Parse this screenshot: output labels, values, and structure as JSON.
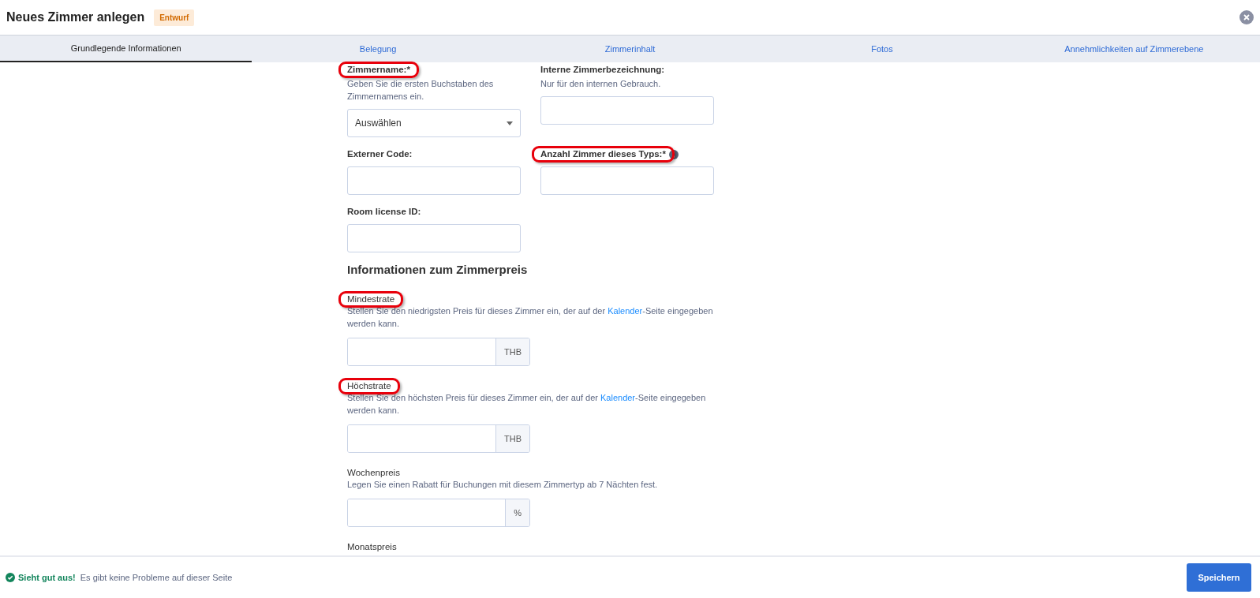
{
  "header": {
    "title": "Neues Zimmer anlegen",
    "badge": "Entwurf"
  },
  "tabs": [
    {
      "label": "Grundlegende Informationen",
      "selected": true
    },
    {
      "label": "Belegung",
      "selected": false
    },
    {
      "label": "Zimmerinhalt",
      "selected": false
    },
    {
      "label": "Fotos",
      "selected": false
    },
    {
      "label": "Annehmlichkeiten auf Zimmerebene",
      "selected": false
    }
  ],
  "basic_rows": [
    [
      {
        "kind": "select",
        "label": "Zimmername:*",
        "highlighted": true,
        "hint": "Geben Sie die ersten Buchstaben des Zimmernamens ein.",
        "value": "Auswählen"
      },
      {
        "kind": "text",
        "label": "Interne Zimmerbezeichnung:",
        "highlighted": false,
        "hint": "Nur für den internen Gebrauch."
      }
    ],
    [
      {
        "kind": "text",
        "label": "Externer Code:",
        "highlighted": false
      },
      {
        "kind": "text",
        "label": "Anzahl Zimmer dieses Typs:*",
        "highlighted": true,
        "info": true
      }
    ],
    [
      {
        "kind": "text",
        "label": "Room license ID:",
        "highlighted": false
      }
    ]
  ],
  "pricing": {
    "heading": "Informationen zum Zimmerpreis",
    "fields": [
      {
        "label": "Mindestrate",
        "highlighted": true,
        "hint_before": "Stellen Sie den niedrigsten Preis für dieses Zimmer ein, der auf der ",
        "link": "Kalender",
        "hint_after": "-Seite eingegeben werden kann.",
        "unit": "THB"
      },
      {
        "label": "Höchstrate",
        "highlighted": true,
        "hint_before": "Stellen Sie den höchsten Preis für dieses Zimmer ein, der auf der ",
        "link": "Kalender",
        "hint_after": "-Seite eingegeben werden kann.",
        "unit": "THB"
      },
      {
        "label": "Wochenpreis",
        "highlighted": false,
        "hint_before": "Legen Sie einen Rabatt für Buchungen mit diesem Zimmertyp ab 7 Nächten fest.",
        "unit": "%"
      },
      {
        "label": "Monatspreis",
        "highlighted": false
      }
    ]
  },
  "footer": {
    "status_title": "Sieht gut aus!",
    "status_message": "Es gibt keine Probleme auf dieser Seite",
    "save_button": "Speichern"
  }
}
